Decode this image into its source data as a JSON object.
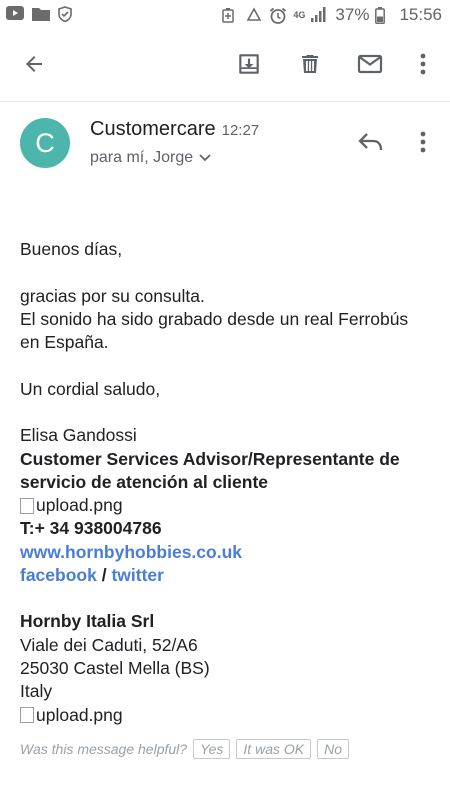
{
  "status_bar": {
    "battery": "37%",
    "time": "15:56",
    "network": "4G"
  },
  "toolbar": {
    "icons": [
      "back-arrow-icon",
      "archive-icon",
      "delete-icon",
      "mark-unread-icon",
      "more-vert-icon"
    ]
  },
  "email": {
    "avatar_letter": "C",
    "avatar_color": "#4db6ac",
    "sender": "Customercare",
    "time": "12:27",
    "recipients": "para mí, Jorge",
    "greeting": "Buenos días,",
    "para1_line1": "gracias por su consulta.",
    "para1_line2": "El sonido ha sido grabado desde un real Ferrobús",
    "para1_line3": "en España.",
    "closing": "Un cordial saludo,",
    "signature": {
      "name": "Elisa Gandossi",
      "role_line1": "Customer Services Advisor/Representante de",
      "role_line2": "servicio de atención al cliente",
      "image1_alt": "upload.png",
      "phone": "T:+ 34 938004786",
      "website": "www.hornbyhobbies.co.uk",
      "facebook": "facebook",
      "separator": "/",
      "twitter": "twitter",
      "company": "Hornby Italia Srl",
      "address1": "Viale dei Caduti, 52/A6",
      "address2": "25030 Castel Mella (BS)",
      "country": "Italy",
      "image2_alt": "upload.png"
    }
  },
  "feedback": {
    "question": "Was this message helpful?",
    "yes": "Yes",
    "ok": "It was OK",
    "no": "No"
  },
  "colors": {
    "link": "#4a7dd6",
    "icon": "#5f6368"
  }
}
